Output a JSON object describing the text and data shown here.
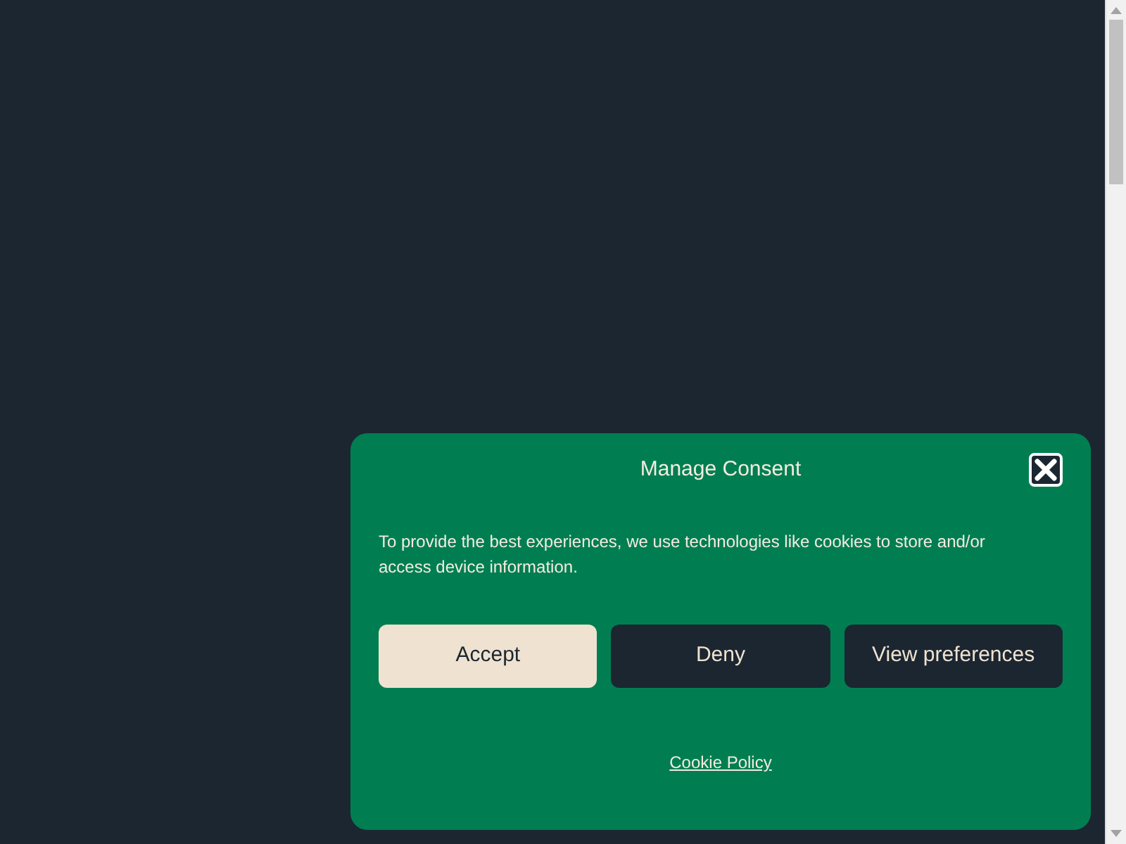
{
  "dialog": {
    "title": "Manage Consent",
    "message": "To provide the best experiences, we use technologies like cookies to store and/or access device information.",
    "buttons": [
      {
        "label": "Accept",
        "kind": "primary"
      },
      {
        "label": "Deny",
        "kind": "secondary"
      },
      {
        "label": "View preferences",
        "kind": "secondary"
      }
    ],
    "link": "Cookie Policy"
  }
}
